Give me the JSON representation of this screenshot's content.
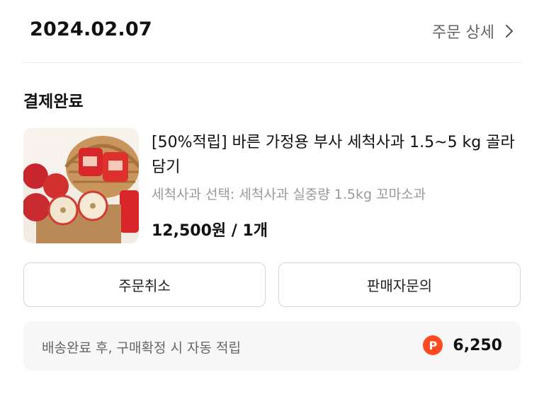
{
  "order": {
    "date": "2024.02.07",
    "detail_link_label": "주문 상세",
    "status": "결제완료"
  },
  "product": {
    "thumbnail_icon": "apple-product-photo",
    "title": "[50%적립] 바른 가정용 부사 세척사과 1.5~5 kg 골라담기",
    "option": "세척사과 선택: 세척사과 실중량 1.5kg 꼬마소과",
    "price": "12,500원 / 1개"
  },
  "actions": {
    "cancel_label": "주문취소",
    "inquiry_label": "판매자문의"
  },
  "points": {
    "label": "배송완료 후, 구매확정 시 자동 적립",
    "icon_label": "P",
    "value": "6,250",
    "icon_color": "#ff4b1f"
  }
}
